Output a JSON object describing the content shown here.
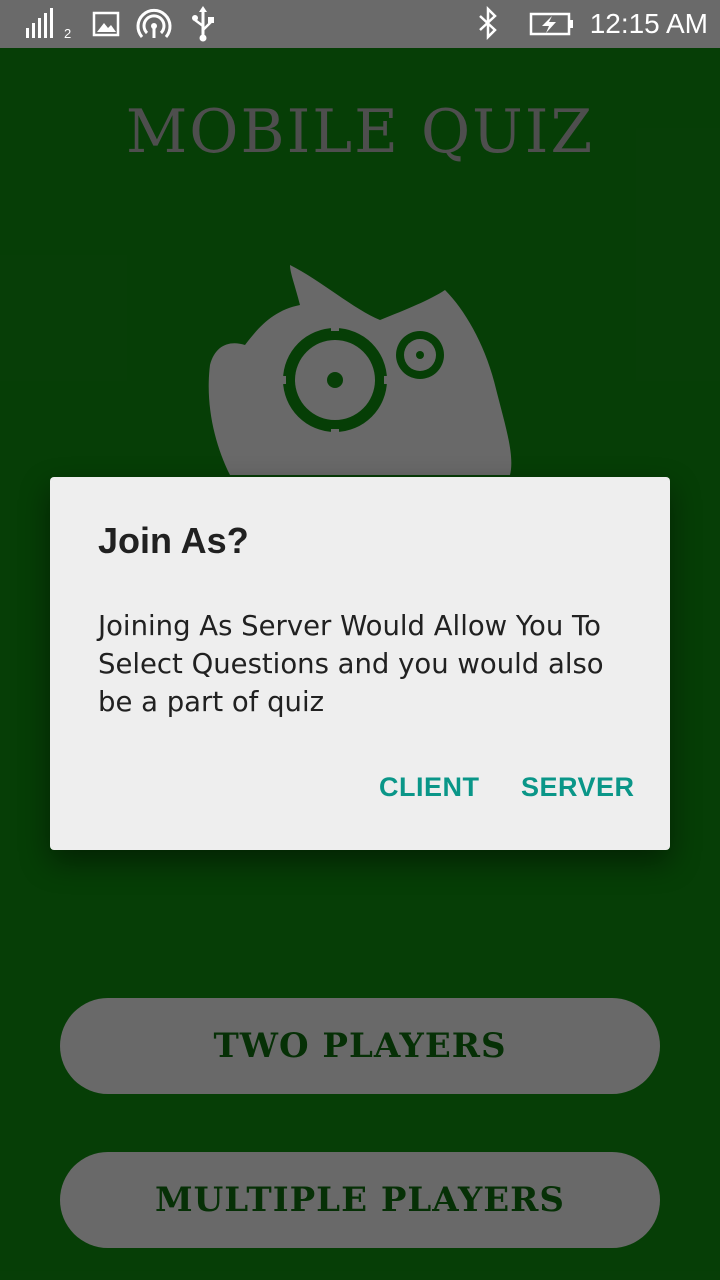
{
  "status_bar": {
    "time": "12:15 AM",
    "signal_sub": "2",
    "icons": [
      "signal-icon",
      "image-icon",
      "hotspot-icon",
      "usb-icon",
      "bluetooth-icon",
      "battery-charging-icon"
    ]
  },
  "app": {
    "title": "MOBILE QUIZ",
    "logo": "gears-logo",
    "buttons": {
      "two_players": "TWO PLAYERS",
      "multiple_players": "MULTIPLE PLAYERS"
    },
    "colors": {
      "background": "#0d7a0d",
      "button_bg": "#cfcfcf",
      "button_text": "#0d5e0d"
    }
  },
  "dialog": {
    "title": "Join As?",
    "message": "Joining As Server Would Allow You To Select Questions and you would also be a part of quiz",
    "buttons": {
      "client": "CLIENT",
      "server": "SERVER"
    },
    "colors": {
      "accent": "#0a9688",
      "background": "#eeeeee"
    }
  }
}
